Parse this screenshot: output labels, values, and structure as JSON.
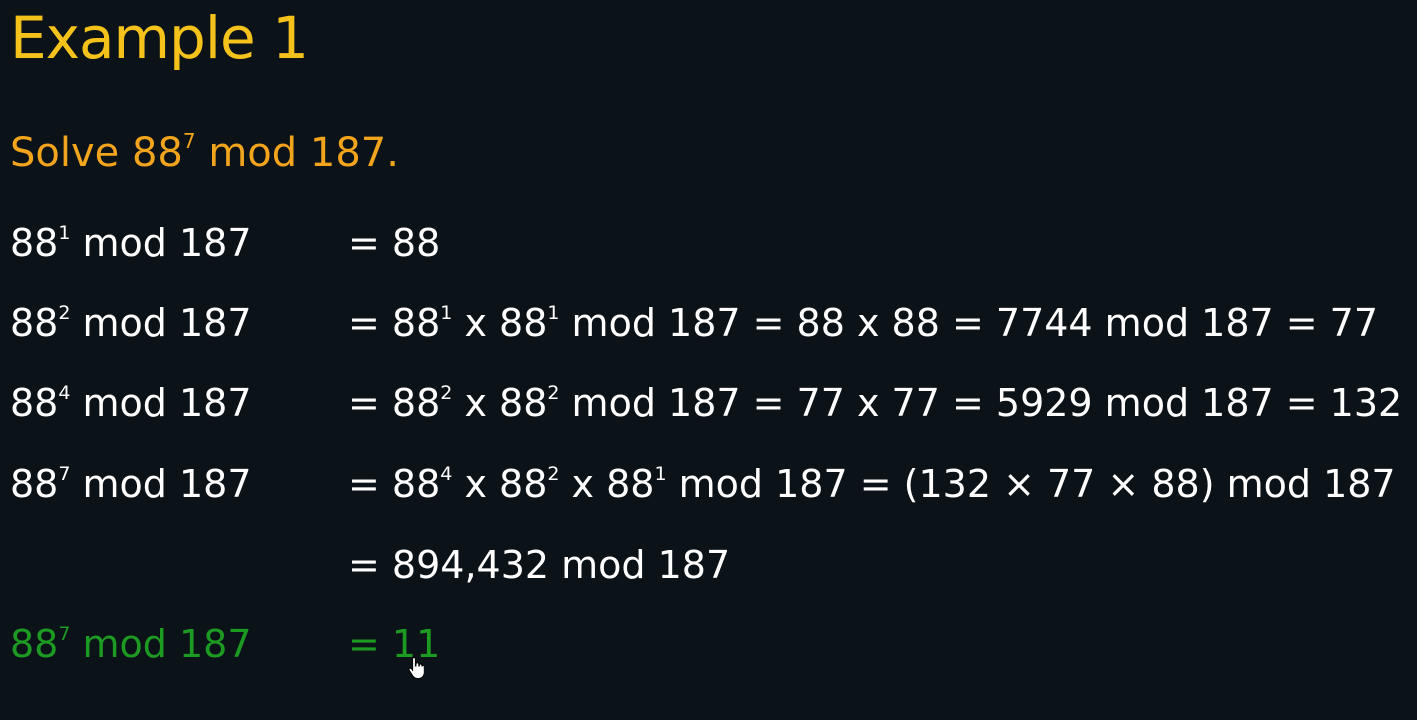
{
  "title": "Example 1",
  "problem": {
    "prefix": "Solve 88",
    "exp": "7",
    "suffix": " mod 187."
  },
  "rows": [
    {
      "lhs": {
        "base": "88",
        "exp": "1",
        "rest": " mod 187"
      },
      "rhs": [
        {
          "t": "= 88"
        }
      ]
    },
    {
      "lhs": {
        "base": "88",
        "exp": "2",
        "rest": " mod 187"
      },
      "rhs": [
        {
          "t": "= 88"
        },
        {
          "s": "1"
        },
        {
          "t": " x 88"
        },
        {
          "s": "1"
        },
        {
          "t": "  mod 187 = 88 x 88 = 7744 mod 187 = 77"
        }
      ]
    },
    {
      "lhs": {
        "base": "88",
        "exp": "4",
        "rest": " mod 187"
      },
      "rhs": [
        {
          "t": "= 88"
        },
        {
          "s": "2"
        },
        {
          "t": " x 88"
        },
        {
          "s": "2"
        },
        {
          "t": " mod 187 = 77 x 77 = 5929 mod 187 = 132"
        }
      ]
    },
    {
      "lhs": {
        "base": "88",
        "exp": "7",
        "rest": " mod 187"
      },
      "rhs": [
        {
          "t": "= 88"
        },
        {
          "s": "4"
        },
        {
          "t": " x 88"
        },
        {
          "s": "2"
        },
        {
          "t": " x 88"
        },
        {
          "s": "1"
        },
        {
          "t": " mod 187 = (132 × 77 × 88) mod 187"
        }
      ]
    },
    {
      "lhs": null,
      "rhs": [
        {
          "t": "= 894,432 mod 187"
        }
      ]
    },
    {
      "lhs": {
        "base": "88",
        "exp": "7",
        "rest": " mod 187"
      },
      "rhs": [
        {
          "t": "= 11"
        }
      ],
      "green": true
    }
  ],
  "colors": {
    "background": "#0b1218",
    "title": "#f4c21a",
    "problem": "#f2a41c",
    "text": "#ffffff",
    "answer": "#1d9a22"
  },
  "icons": {
    "cursor": "hand-pointer-icon"
  }
}
